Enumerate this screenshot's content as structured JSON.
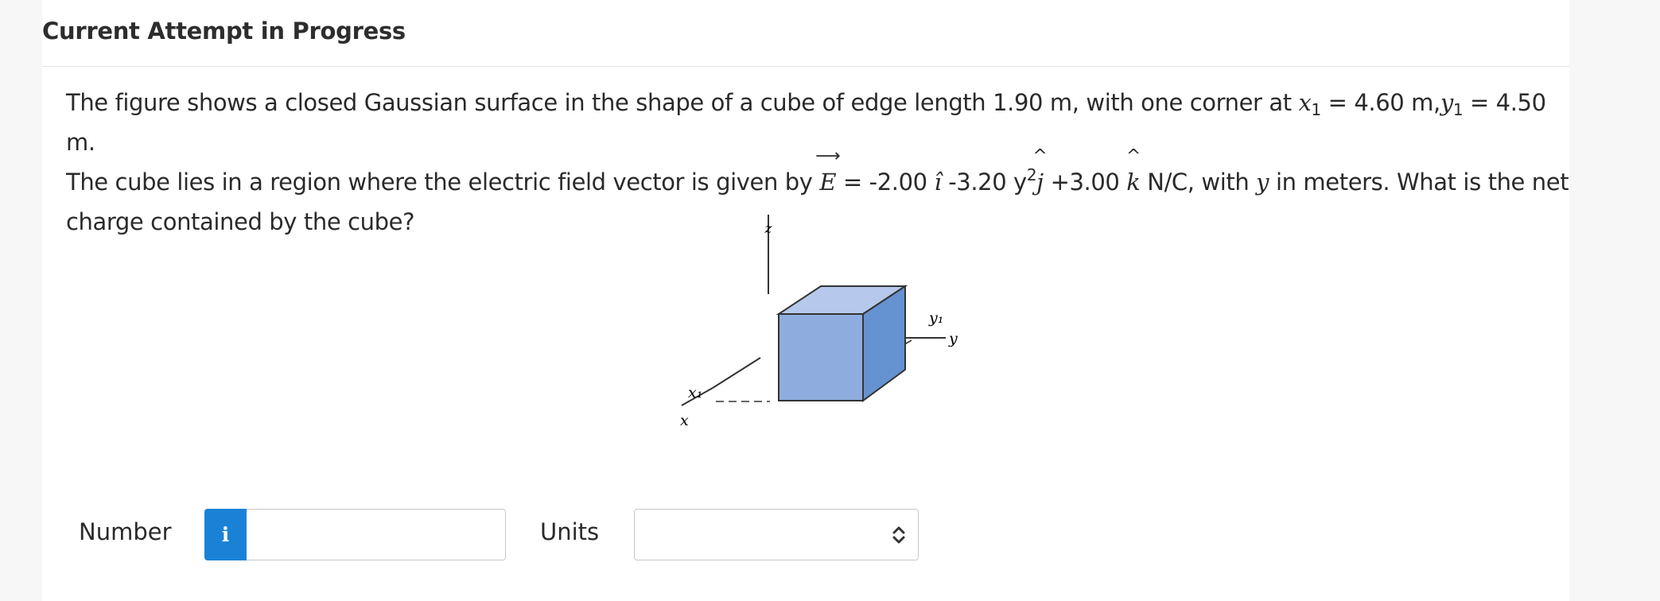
{
  "header": {
    "title": "Current Attempt in Progress"
  },
  "question": {
    "p1": "The figure shows a closed Gaussian surface in the shape of a cube of edge length 1.90 m, with one corner at ",
    "x_var": "x",
    "x_sub": "1",
    "x_eq": " = 4.60 m,",
    "y_var": "y",
    "y_sub": "1",
    "y_eq": " = 4.50 m.",
    "p2": "The cube lies in a region where the electric field vector is given by ",
    "e_symbol": "E",
    "term_i": " = -2.00 ",
    "i_symbol": "î",
    "term_j": " -3.20 y",
    "j_exp": "2",
    "j_symbol": "j",
    "term_k": " +3.00 ",
    "k_symbol": "k",
    "p3": " N/C, with ",
    "p3_var": "y",
    "p3_tail": " in meters. What is the net charge contained by the cube?"
  },
  "figure": {
    "z_label": "z",
    "y_label": "y",
    "y1_label": "y₁",
    "x_label": "x",
    "x1_label": "x₁",
    "colors": {
      "front": "#8eadde",
      "top": "#b6c9ec",
      "side": "#6592d1",
      "edge": "#333333"
    }
  },
  "answer": {
    "number_label": "Number",
    "info_icon": "i",
    "number_value": "",
    "units_label": "Units",
    "units_value": "",
    "accent": "#1a82d6"
  }
}
